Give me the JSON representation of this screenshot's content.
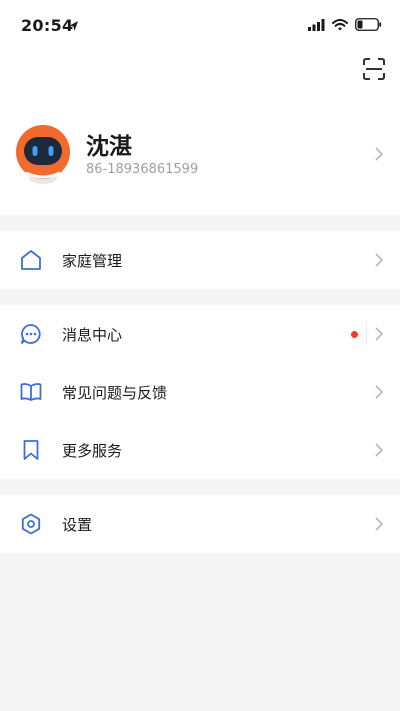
{
  "status_bar": {
    "time": "20:54",
    "icons": [
      "location-arrow-icon",
      "cellular-signal-icon",
      "wifi-icon",
      "battery-icon"
    ]
  },
  "header": {
    "scan_icon": "scan-icon"
  },
  "profile": {
    "name": "沈湛",
    "phone": "86-18936861599",
    "avatar": "robot-avatar"
  },
  "menu_groups": [
    {
      "items": [
        {
          "label": "家庭管理",
          "icon": "home-icon"
        }
      ]
    },
    {
      "items": [
        {
          "label": "消息中心",
          "icon": "message-icon",
          "badge": "red-dot"
        },
        {
          "label": "常见问题与反馈",
          "icon": "book-icon"
        },
        {
          "label": "更多服务",
          "icon": "bookmark-icon"
        }
      ]
    },
    {
      "items": [
        {
          "label": "设置",
          "icon": "settings-icon"
        }
      ]
    }
  ],
  "colors": {
    "accent": "#3a6fe0",
    "background": "#f5f5f5",
    "badge": "#f23b2e",
    "avatar": "#f26a2e"
  }
}
